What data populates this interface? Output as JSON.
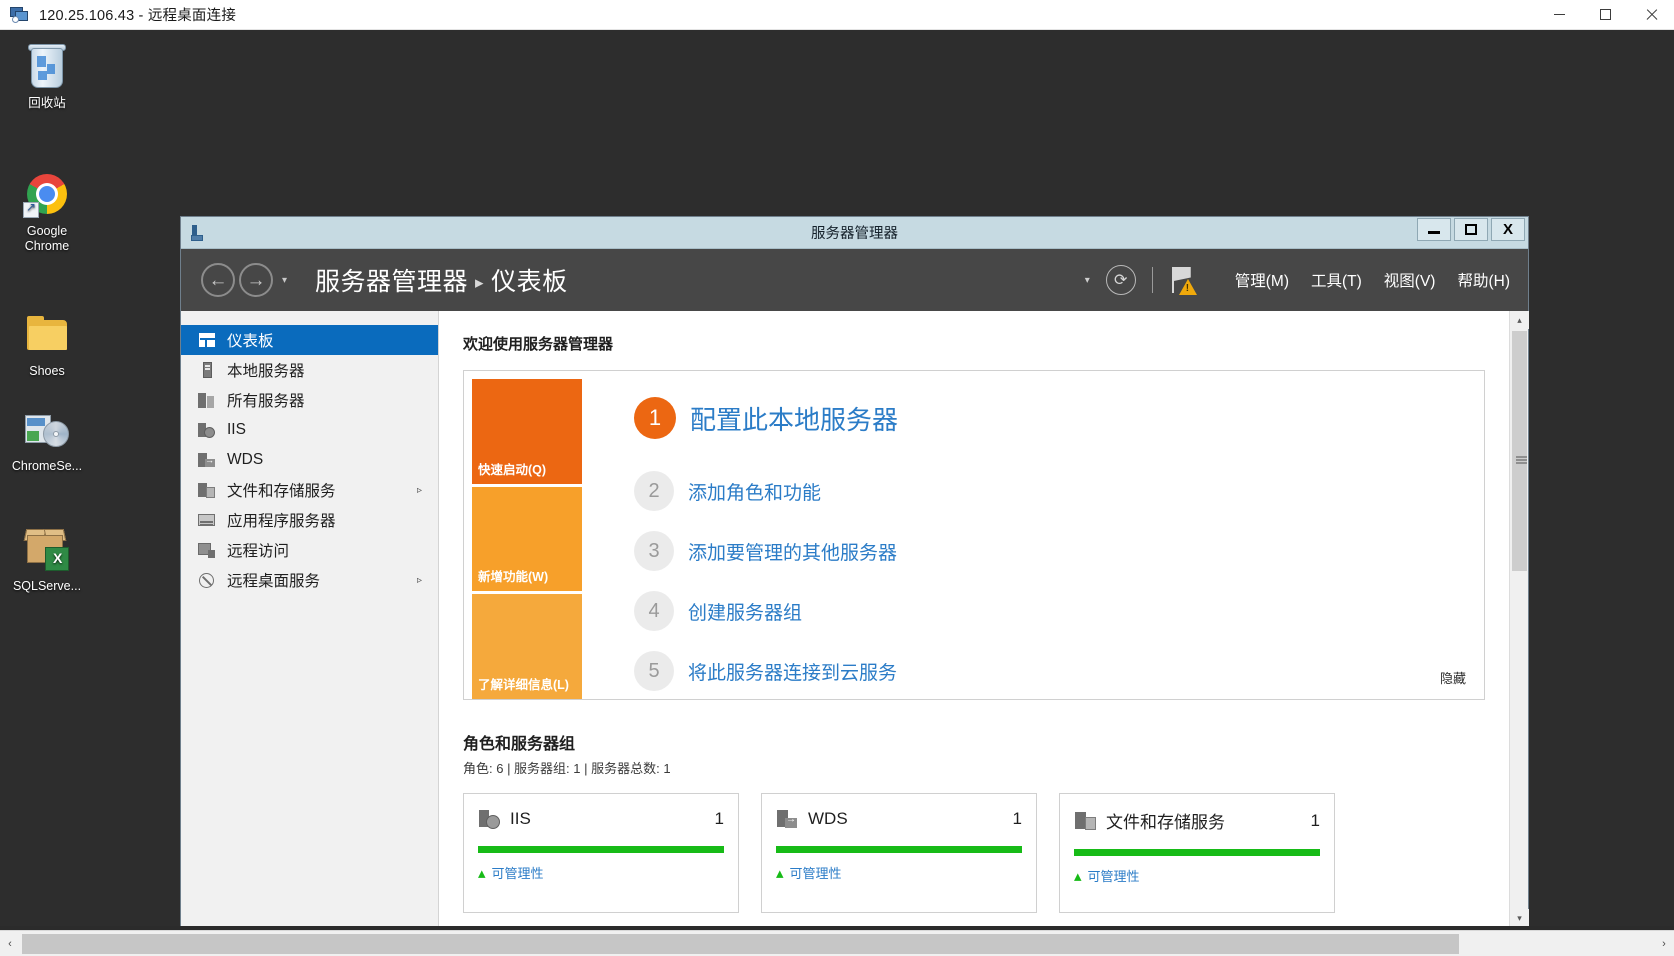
{
  "rdp": {
    "title": "120.25.106.43 - 远程桌面连接",
    "icon": "remote-desktop-icon",
    "buttons": {
      "minimize": "–",
      "maximize": "☐",
      "close": "✕"
    }
  },
  "desktop": {
    "icons": [
      {
        "label": "回收站",
        "icon": "recycle-bin-icon"
      },
      {
        "label": "Google\nChrome",
        "label_line1": "Google",
        "label_line2": "Chrome",
        "icon": "google-chrome-icon"
      },
      {
        "label": "Shoes",
        "icon": "folder-icon"
      },
      {
        "label": "ChromeSe...",
        "icon": "chrome-setup-installer-icon"
      },
      {
        "label": "SQLServe...",
        "icon": "sqlserver-package-icon"
      }
    ]
  },
  "server_manager": {
    "window_title": "服务器管理器",
    "titlebar_buttons": {
      "minimize": "minimize-icon",
      "maximize": "maximize-icon",
      "close": "X"
    },
    "nav": {
      "back": "←",
      "forward": "→",
      "dropdown_caret": "▾",
      "breadcrumb_root": "服务器管理器",
      "breadcrumb_sep": "▸",
      "breadcrumb_current": "仪表板",
      "notifications_caret": "▾",
      "refresh": "⟳",
      "flag_badge": "warning",
      "menus": [
        {
          "label": "管理(M)"
        },
        {
          "label": "工具(T)"
        },
        {
          "label": "视图(V)"
        },
        {
          "label": "帮助(H)"
        }
      ]
    },
    "sidebar": {
      "items": [
        {
          "label": "仪表板",
          "icon": "dashboard-grid-icon",
          "active": true,
          "expandable": false
        },
        {
          "label": "本地服务器",
          "icon": "server-icon",
          "active": false,
          "expandable": false
        },
        {
          "label": "所有服务器",
          "icon": "all-servers-icon",
          "active": false,
          "expandable": false
        },
        {
          "label": "IIS",
          "icon": "iis-icon",
          "active": false,
          "expandable": false
        },
        {
          "label": "WDS",
          "icon": "wds-icon",
          "active": false,
          "expandable": false
        },
        {
          "label": "文件和存储服务",
          "icon": "file-storage-icon",
          "active": false,
          "expandable": true,
          "arrow": "▹"
        },
        {
          "label": "应用程序服务器",
          "icon": "app-server-icon",
          "active": false,
          "expandable": false
        },
        {
          "label": "远程访问",
          "icon": "remote-access-icon",
          "active": false,
          "expandable": false
        },
        {
          "label": "远程桌面服务",
          "icon": "remote-desktop-services-icon",
          "active": false,
          "expandable": true,
          "arrow": "▹"
        }
      ]
    },
    "welcome": {
      "heading": "欢迎使用服务器管理器",
      "quick_blocks": [
        {
          "label": "快速启动(Q)",
          "color": "#ec6712"
        },
        {
          "label": "新增功能(W)",
          "color": "#f7a02a"
        },
        {
          "label": "了解详细信息(L)",
          "color": "#f5a93c"
        }
      ],
      "steps": [
        {
          "num": "1",
          "text": "配置此本地服务器",
          "primary": true
        },
        {
          "num": "2",
          "text": "添加角色和功能",
          "primary": false
        },
        {
          "num": "3",
          "text": "添加要管理的其他服务器",
          "primary": false
        },
        {
          "num": "4",
          "text": "创建服务器组",
          "primary": false
        },
        {
          "num": "5",
          "text": "将此服务器连接到云服务",
          "primary": false
        }
      ],
      "hide_label": "隐藏"
    },
    "roles": {
      "title": "角色和服务器组",
      "summary": "角色: 6 | 服务器组: 1 | 服务器总数: 1",
      "tiles": [
        {
          "name": "IIS",
          "count": "1",
          "icon": "iis-icon",
          "bar_color": "#17bb17",
          "status": "可管理性"
        },
        {
          "name": "WDS",
          "count": "1",
          "icon": "wds-icon",
          "bar_color": "#17bb17",
          "status": "可管理性"
        },
        {
          "name": "文件和存储服务",
          "count": "1",
          "icon": "file-storage-icon",
          "bar_color": "#17bb17",
          "status": "可管理性"
        }
      ]
    },
    "scrollbar": {
      "up": "▴",
      "down": "▾"
    }
  },
  "rdp_scrollbar": {
    "left": "‹",
    "right": "›"
  },
  "colors": {
    "accent_blue": "#0a6bbd",
    "link_blue": "#2b7cc7",
    "orange_primary": "#ec6712",
    "orange_light": "#f7a02a",
    "status_green": "#17bb17",
    "nav_dark": "#474747",
    "titlebar_blue": "#c6dae2"
  }
}
